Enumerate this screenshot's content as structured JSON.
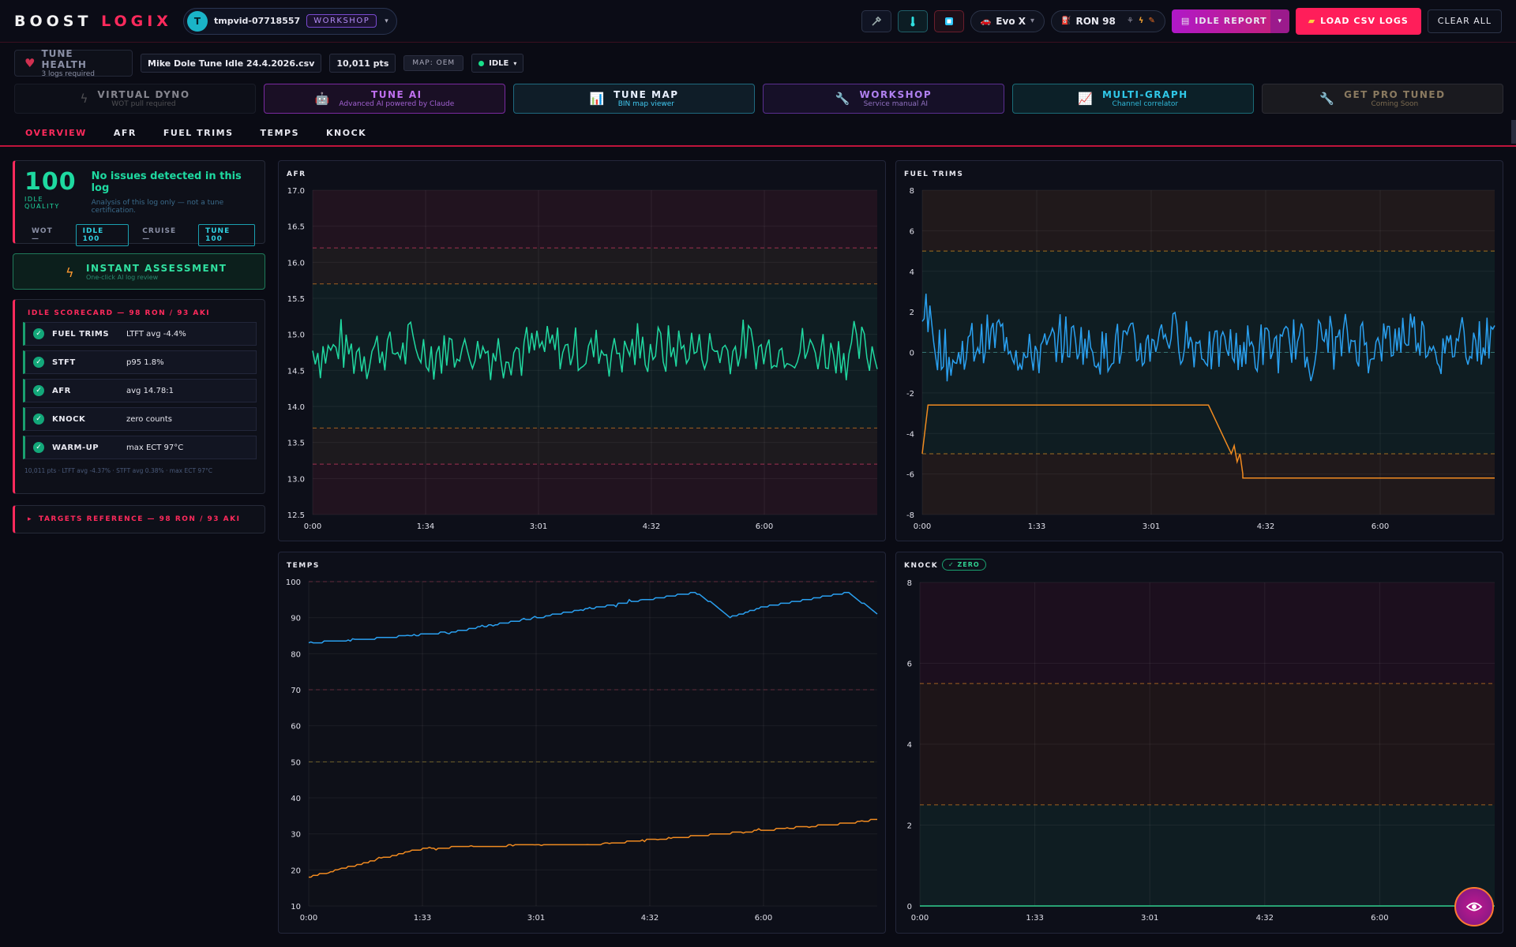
{
  "brand": {
    "part1": "BOOST",
    "part2": "LOGIX"
  },
  "user": {
    "initial": "T",
    "name": "tmpvid-07718557",
    "badge": "WORKSHOP"
  },
  "header": {
    "vehicle": "Evo X",
    "fuel": "RON 98",
    "idle_report": "IDLE REPORT",
    "load_csv": "LOAD CSV LOGS",
    "clear_all": "CLEAR ALL"
  },
  "status": {
    "tune_health_title": "TUNE HEALTH",
    "tune_health_sub": "3 logs required",
    "file": "Mike Dole Tune Idle 24.4.2026.csv",
    "points": "10,011 pts",
    "map": "MAP: OEM",
    "mode": "IDLE"
  },
  "tools": [
    {
      "title": "VIRTUAL DYNO",
      "sub": "WOT pull required"
    },
    {
      "title": "TUNE AI",
      "sub": "Advanced AI powered by Claude"
    },
    {
      "title": "TUNE MAP",
      "sub": "BIN map viewer"
    },
    {
      "title": "WORKSHOP",
      "sub": "Service manual AI"
    },
    {
      "title": "MULTI-GRAPH",
      "sub": "Channel correlator"
    },
    {
      "title": "GET PRO TUNED",
      "sub": "Coming Soon"
    }
  ],
  "tabs": [
    "OVERVIEW",
    "AFR",
    "FUEL TRIMS",
    "TEMPS",
    "KNOCK"
  ],
  "quality": {
    "score": "100",
    "label": "IDLE QUALITY",
    "message": "No issues detected in this log",
    "note": "Analysis of this log only — not a tune certification.",
    "chips": [
      "WOT —",
      "IDLE 100",
      "CRUISE —",
      "TUNE 100"
    ]
  },
  "instant": {
    "title": "INSTANT ASSESSMENT",
    "sub": "One-click AI log review"
  },
  "scorecard": {
    "title": "IDLE SCORECARD — 98 RON / 93 AKI",
    "rows": [
      {
        "name": "FUEL TRIMS",
        "value": "LTFT avg -4.4%"
      },
      {
        "name": "STFT",
        "value": "p95 1.8%"
      },
      {
        "name": "AFR",
        "value": "avg 14.78:1"
      },
      {
        "name": "KNOCK",
        "value": "zero counts"
      },
      {
        "name": "WARM-UP",
        "value": "max ECT 97°C"
      }
    ],
    "footer": "10,011 pts · LTFT avg -4.37% · STFT avg 0.38% · max ECT 97°C"
  },
  "targets": "TARGETS REFERENCE — 98 RON / 93 AKI",
  "chart_data": [
    {
      "type": "line",
      "title": "AFR",
      "x_ticks": [
        "0:00",
        "1:34",
        "3:01",
        "4:32",
        "6:00"
      ],
      "ylim": [
        12.5,
        17.0
      ],
      "y_ticks": [
        "17.0",
        "16.5",
        "16.0",
        "15.5",
        "15.0",
        "14.5",
        "14.0",
        "13.5",
        "13.0",
        "12.5"
      ],
      "bands": {
        "lean_warn": [
          15.7,
          16.2
        ],
        "rich_warn": [
          13.2,
          13.7
        ]
      },
      "series": [
        {
          "color": "#20d8a0",
          "mean": 14.78,
          "min": 14.3,
          "max": 15.3
        }
      ]
    },
    {
      "type": "line",
      "title": "FUEL TRIMS",
      "x_ticks": [
        "0:00",
        "1:33",
        "3:01",
        "4:32",
        "6:00"
      ],
      "ylim": [
        -8,
        8
      ],
      "y_ticks": [
        "8",
        "6",
        "4",
        "2",
        "0",
        "-2",
        "-4",
        "-6",
        "-8"
      ],
      "bands": {
        "limits": [
          -5,
          5
        ]
      },
      "series": [
        {
          "color": "#2aa0f0",
          "kind": "stft",
          "mean": 0.38
        },
        {
          "color": "#f08a20",
          "kind": "ltft",
          "steps": [
            [
              0,
              -5.0
            ],
            [
              0.01,
              -2.6
            ],
            [
              0.5,
              -2.6
            ],
            [
              0.54,
              -5.0
            ],
            [
              0.56,
              -6.2
            ],
            [
              1.0,
              -6.2
            ]
          ]
        }
      ]
    },
    {
      "type": "line",
      "title": "TEMPS",
      "x_ticks": [
        "0:00",
        "1:33",
        "3:01",
        "4:32",
        "6:00"
      ],
      "ylim": [
        10,
        100
      ],
      "y_ticks": [
        "100",
        "90",
        "80",
        "70",
        "60",
        "50",
        "40",
        "30",
        "20",
        "10"
      ],
      "series": [
        {
          "color": "#2aa0f0",
          "kind": "ect",
          "points": [
            [
              0,
              83
            ],
            [
              0.1,
              84
            ],
            [
              0.25,
              86
            ],
            [
              0.4,
              90
            ],
            [
              0.55,
              94
            ],
            [
              0.68,
              97
            ],
            [
              0.72,
              93
            ],
            [
              0.74,
              90
            ],
            [
              0.8,
              93
            ],
            [
              0.95,
              97
            ],
            [
              1.0,
              91
            ]
          ]
        },
        {
          "color": "#f08a20",
          "kind": "iat",
          "points": [
            [
              0,
              18
            ],
            [
              0.1,
              22
            ],
            [
              0.2,
              26
            ],
            [
              0.4,
              27
            ],
            [
              0.5,
              27
            ],
            [
              0.65,
              29
            ],
            [
              0.8,
              31
            ],
            [
              0.95,
              33
            ],
            [
              1.0,
              34
            ]
          ]
        }
      ]
    },
    {
      "type": "line",
      "title": "KNOCK",
      "badge": "✓ ZERO",
      "x_ticks": [
        "0:00",
        "1:33",
        "3:01",
        "4:32",
        "6:00"
      ],
      "ylim": [
        0,
        8
      ],
      "y_ticks": [
        "8",
        "6",
        "4",
        "2",
        "0"
      ],
      "series": [
        {
          "color": "#30d090",
          "values": "zero"
        }
      ]
    }
  ]
}
